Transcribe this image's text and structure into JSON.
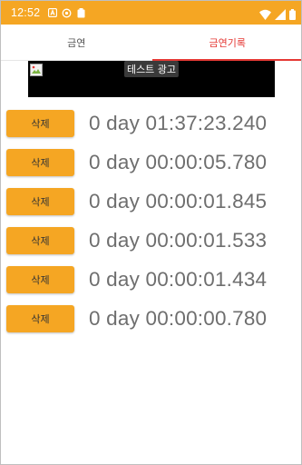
{
  "status_bar": {
    "time": "12:52",
    "background": "#f5a623",
    "left_icons": [
      "notification-a-icon",
      "sync-icon",
      "clipboard-icon"
    ],
    "right_icons": [
      "wifi-icon",
      "signal-icon",
      "battery-icon"
    ]
  },
  "tabs": [
    {
      "label": "금연",
      "active": false
    },
    {
      "label": "금연기록",
      "active": true
    }
  ],
  "ad": {
    "label": "테스트 광고"
  },
  "records": [
    {
      "delete_label": "삭제",
      "time": "0 day 01:37:23.240"
    },
    {
      "delete_label": "삭제",
      "time": "0 day 00:00:05.780"
    },
    {
      "delete_label": "삭제",
      "time": "0 day 00:00:01.845"
    },
    {
      "delete_label": "삭제",
      "time": "0 day 00:00:01.533"
    },
    {
      "delete_label": "삭제",
      "time": "0 day 00:00:01.434"
    },
    {
      "delete_label": "삭제",
      "time": "0 day 00:00:00.780"
    }
  ],
  "colors": {
    "accent": "#f5a623",
    "active_tab": "#e53935",
    "record_text": "#6e6e6e"
  }
}
